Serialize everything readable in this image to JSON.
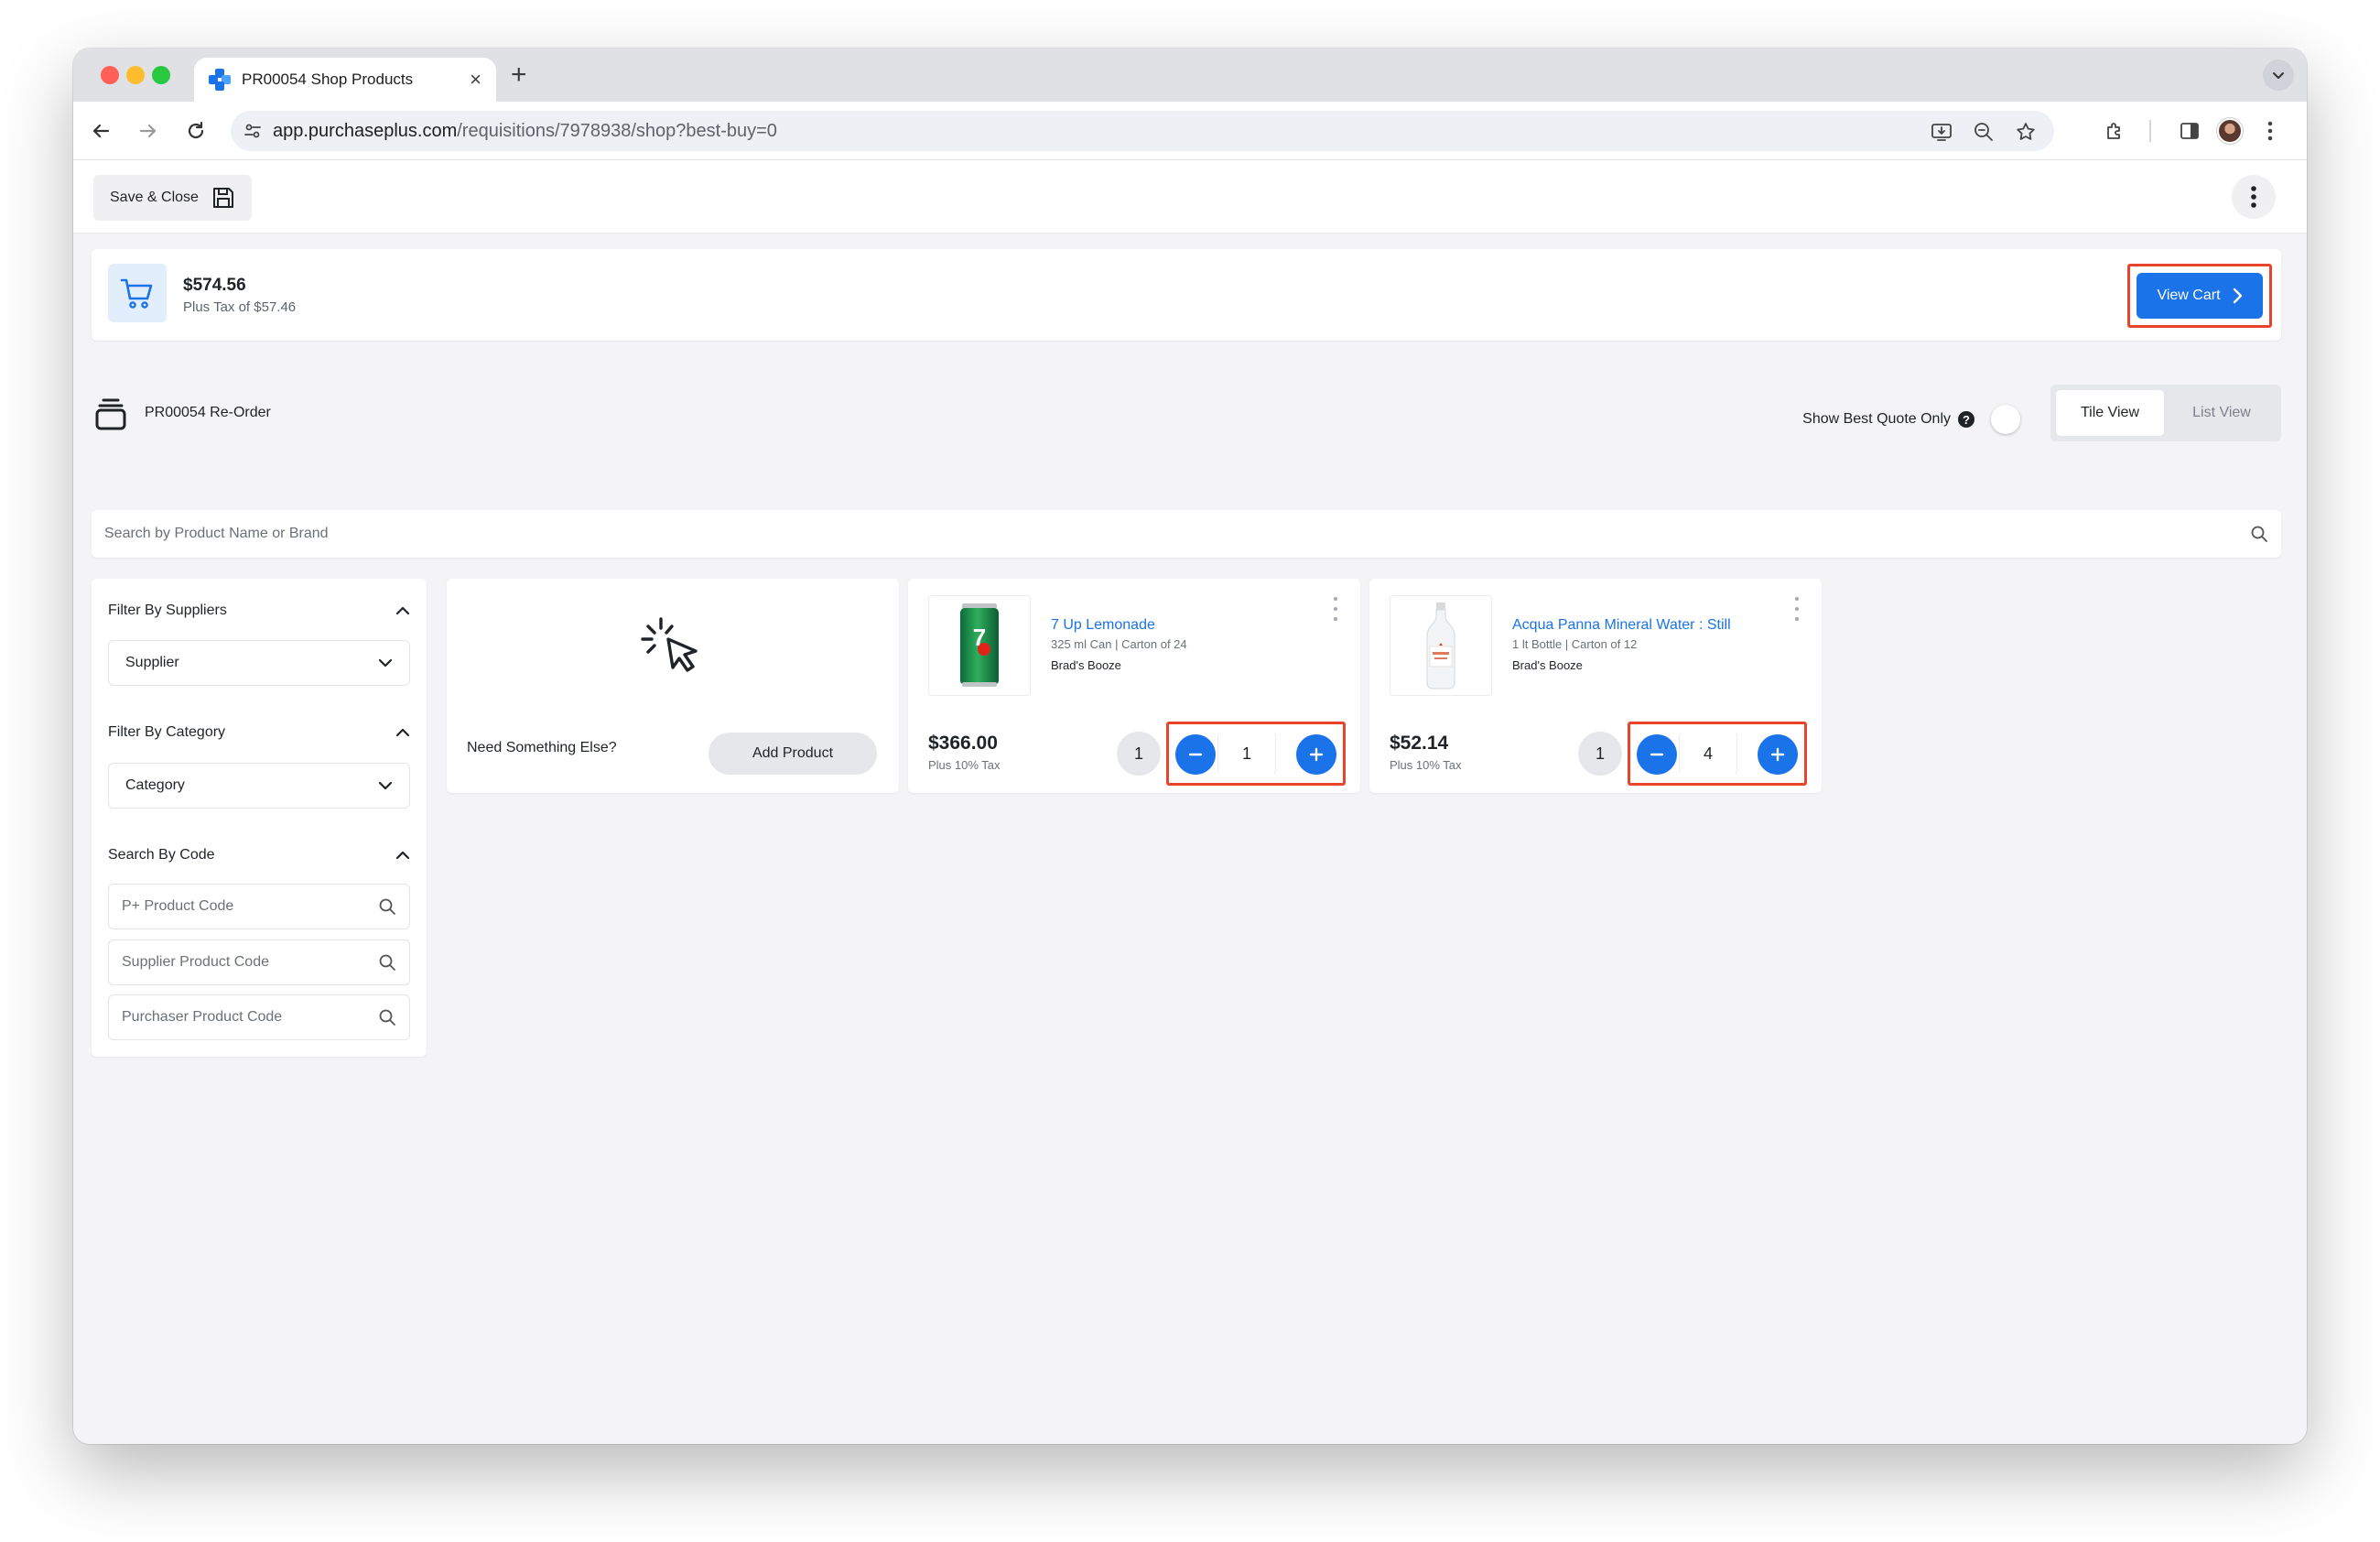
{
  "browser": {
    "tab_title": "PR00054 Shop Products",
    "tab_close": "×",
    "new_tab": "+",
    "url_host": "app.purchaseplus.com",
    "url_path": "/requisitions/7978938/shop?best-buy=0"
  },
  "header": {
    "save_close_label": "Save & Close"
  },
  "summary": {
    "total": "$574.56",
    "tax": "Plus Tax of $57.46",
    "view_cart_label": "View Cart"
  },
  "catalog": {
    "title": "PR00054 Re-Order",
    "best_quote_label": "Show Best Quote Only",
    "help_glyph": "?",
    "view_options": [
      "Tile View",
      "List View"
    ],
    "active_view": "Tile View"
  },
  "search": {
    "placeholder": "Search by Product Name or Brand"
  },
  "filters": {
    "suppliers_heading": "Filter By Suppliers",
    "supplier_select": "Supplier",
    "category_heading": "Filter By Category",
    "category_select": "Category",
    "code_heading": "Search By Code",
    "code_placeholders": [
      "P+ Product Code",
      "Supplier Product Code",
      "Purchaser Product Code"
    ]
  },
  "add_tile": {
    "prompt": "Need Something Else?",
    "button_label": "Add Product"
  },
  "products": [
    {
      "name": "7 Up Lemonade",
      "size": "325 ml Can | Carton of 24",
      "supplier": "Brad's Booze",
      "price": "$366.00",
      "tax": "Plus 10% Tax",
      "badge": "1",
      "quantity": "1"
    },
    {
      "name": "Acqua Panna Mineral Water : Still",
      "size": "1 lt Bottle | Carton of 12",
      "supplier": "Brad's Booze",
      "price": "$52.14",
      "tax": "Plus 10% Tax",
      "badge": "1",
      "quantity": "4"
    }
  ],
  "colors": {
    "accent": "#1a73e8",
    "highlight": "#e8432b",
    "background": "#f4f4f7"
  }
}
